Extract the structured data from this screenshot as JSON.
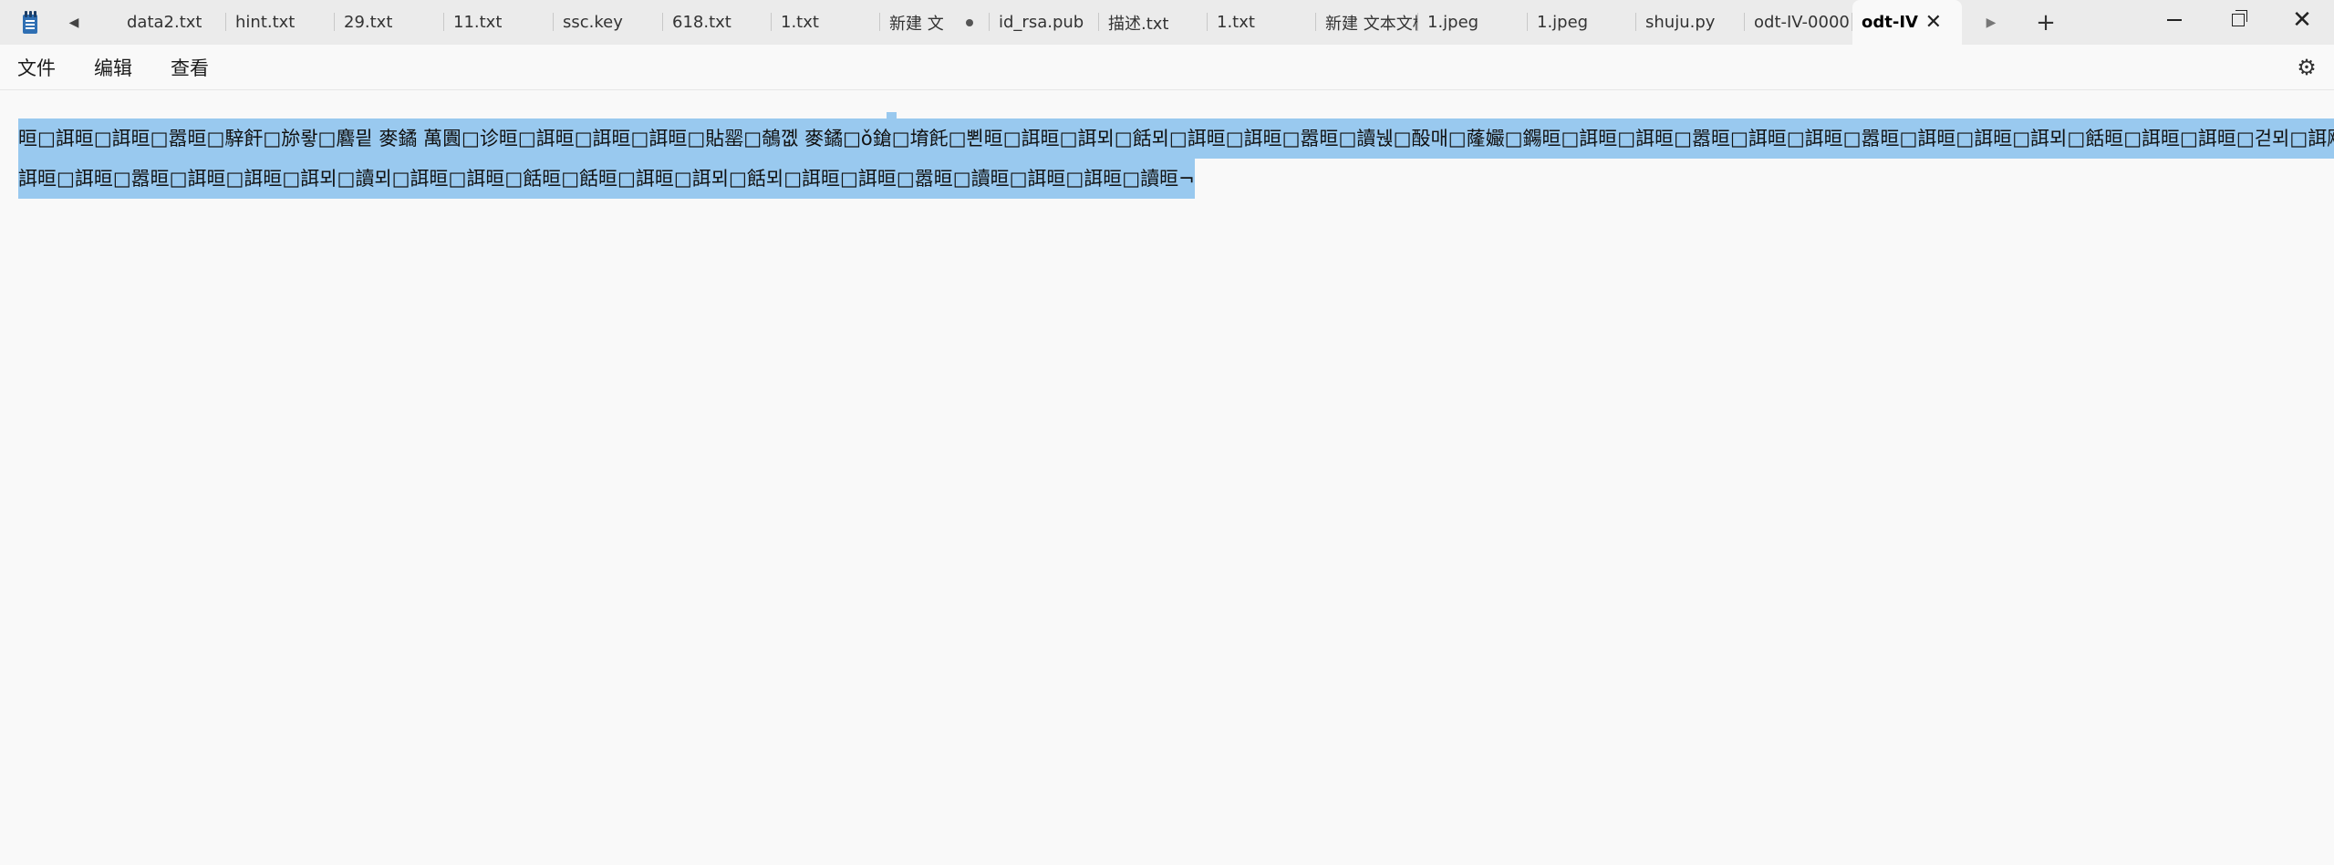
{
  "tabbar": {
    "tabs": [
      {
        "label": "data2.txt",
        "modified": false
      },
      {
        "label": "hint.txt",
        "modified": false
      },
      {
        "label": "29.txt",
        "modified": false
      },
      {
        "label": "11.txt",
        "modified": false
      },
      {
        "label": "ssc.key",
        "modified": false
      },
      {
        "label": "618.txt",
        "modified": false
      },
      {
        "label": "1.txt",
        "modified": false
      },
      {
        "label": "新建 文",
        "modified": true
      },
      {
        "label": "id_rsa.pub",
        "modified": false
      },
      {
        "label": "描述.txt",
        "modified": false
      },
      {
        "label": "1.txt",
        "modified": false
      },
      {
        "label": "新建 文本文档",
        "modified": false
      },
      {
        "label": "1.jpeg",
        "modified": false
      },
      {
        "label": "1.jpeg",
        "modified": false
      },
      {
        "label": "shuju.py",
        "modified": false
      },
      {
        "label": "odt-IV-0000",
        "modified": false
      }
    ],
    "active_tab": {
      "label": "odt-IV",
      "close_glyph": "✕"
    },
    "nav_left_glyph": "◀",
    "nav_right_glyph": "▶",
    "add_glyph": "+",
    "close_glyph": "✕"
  },
  "menubar": {
    "file": "文件",
    "edit": "编辑",
    "view": "查看",
    "settings_glyph": "⚙"
  },
  "editor": {
    "line1": "晅□誀晅□誀晅□嚣晅□騂飦□旀뢓□麔믵   麥鐍    萬圚□诊晅□誀晅□誀晅□誀晅□貼罂□鵸꼢    麥鐍□ǒ鎗□堉飥□뾘晅□誀晅□誀뫼□餂뫼□誀晅□誀晅□嚣晅□讀뉁□酘매□蕯孍□鐊晅□誀晅□誀晅□嚣晅□誀晅□誀晅□嚣晅□誀晅□誀晅□誀뫼□餂晅□誀晅□誀晅□걷뫼□誀飑□",
    "line2": "誀晅□誀晅□嚣晅□誀晅□誀晅□誀뫼□讀뫼□誀晅□誀晅□餂晅□餂晅□誀晅□誀뫼□餂뫼□誀晅□誀晅□嚣晅□讀晅□誀晅□誀晅□讀晅¬"
  },
  "colors": {
    "tabbar_bg": "#ebebeb",
    "editor_bg": "#f9f9f9",
    "selection": "#99c9ef"
  }
}
